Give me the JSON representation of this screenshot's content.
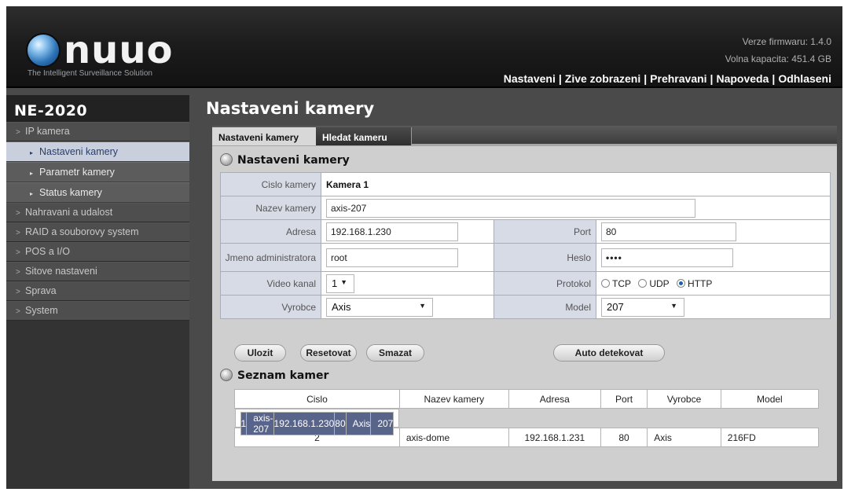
{
  "header": {
    "logo_text": "nuuo",
    "tagline": "The Intelligent Surveillance Solution",
    "firmware": "Verze firmwaru: 1.4.0",
    "capacity": "Volna kapacita: 451.4 GB",
    "nav": [
      "Nastaveni",
      "Zive zobrazeni",
      "Prehravani",
      "Napoveda",
      "Odhlaseni"
    ]
  },
  "sidebar": {
    "model": "NE-2020",
    "items": [
      {
        "label": "IP kamera"
      },
      {
        "label": "Nastaveni kamery"
      },
      {
        "label": "Parametr kamery"
      },
      {
        "label": "Status kamery"
      },
      {
        "label": "Nahravani a udalost"
      },
      {
        "label": "RAID a souborovy system"
      },
      {
        "label": "POS a I/O"
      },
      {
        "label": "Sitove nastaveni"
      },
      {
        "label": "Sprava"
      },
      {
        "label": "System"
      }
    ]
  },
  "main": {
    "title": "Nastaveni kamery",
    "tabs": [
      "Nastaveni kamery",
      "Hledat kameru"
    ],
    "section1": "Nastaveni kamery",
    "form": {
      "camera_number_label": "Cislo kamery",
      "camera_number": "Kamera 1",
      "camera_name_label": "Nazev kamery",
      "camera_name": "axis-207",
      "address_label": "Adresa",
      "address": "192.168.1.230",
      "port_label": "Port",
      "port": "80",
      "admin_label": "Jmeno administratora",
      "admin": "root",
      "password_label": "Heslo",
      "password": "••••",
      "channel_label": "Video kanal",
      "channel": "1",
      "protocol_label": "Protokol",
      "protocols": [
        "TCP",
        "UDP",
        "HTTP"
      ],
      "vendor_label": "Vyrobce",
      "vendor": "Axis",
      "model_label": "Model",
      "model": "207"
    },
    "buttons": {
      "save": "Ulozit",
      "reset": "Resetovat",
      "delete": "Smazat",
      "auto": "Auto detekovat"
    },
    "section2": "Seznam kamer",
    "list": {
      "headers": [
        "Cislo",
        "Nazev kamery",
        "Adresa",
        "Port",
        "Vyrobce",
        "Model"
      ],
      "rows": [
        [
          "1",
          "axis-207",
          "192.168.1.230",
          "80",
          "Axis",
          "207"
        ],
        [
          "2",
          "axis-dome",
          "192.168.1.231",
          "80",
          "Axis",
          "216FD"
        ]
      ]
    }
  }
}
